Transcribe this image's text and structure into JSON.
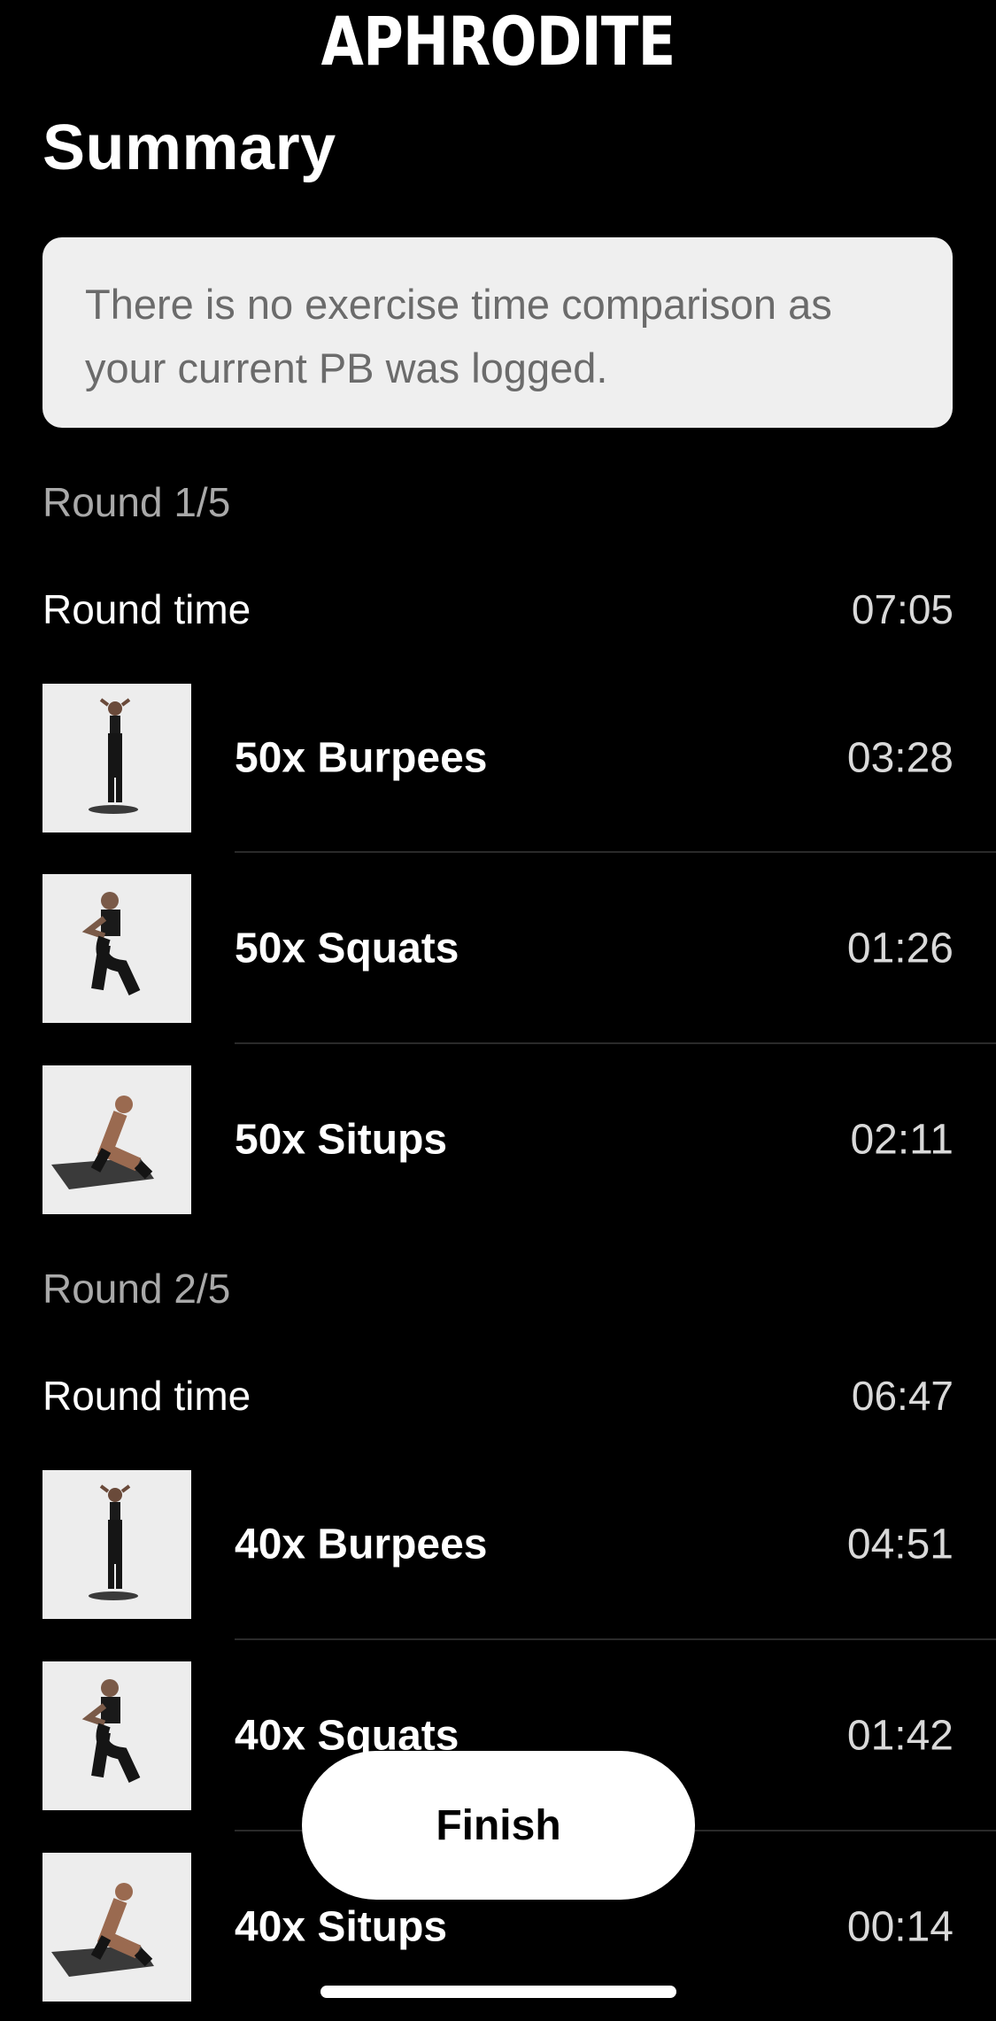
{
  "app": {
    "brand": "APHRODITE"
  },
  "page": {
    "title": "Summary"
  },
  "notice": {
    "text": "There is no exercise time comparison as your current PB was logged."
  },
  "rounds": [
    {
      "label": "Round 1/5",
      "round_time_label": "Round time",
      "round_time": "07:05",
      "exercises": [
        {
          "name": "50x Burpees",
          "time": "03:28",
          "icon": "burpee-photo"
        },
        {
          "name": "50x Squats",
          "time": "01:26",
          "icon": "squat-photo"
        },
        {
          "name": "50x Situps",
          "time": "02:11",
          "icon": "situp-photo"
        }
      ]
    },
    {
      "label": "Round 2/5",
      "round_time_label": "Round time",
      "round_time": "06:47",
      "exercises": [
        {
          "name": "40x Burpees",
          "time": "04:51",
          "icon": "burpee-photo"
        },
        {
          "name": "40x Squats",
          "time": "01:42",
          "icon": "squat-photo"
        },
        {
          "name": "40x Situps",
          "time": "00:14",
          "icon": "situp-photo"
        }
      ]
    }
  ],
  "actions": {
    "finish_label": "Finish"
  },
  "colors": {
    "background": "#000000",
    "card": "#efefef",
    "button": "#ffffff"
  }
}
